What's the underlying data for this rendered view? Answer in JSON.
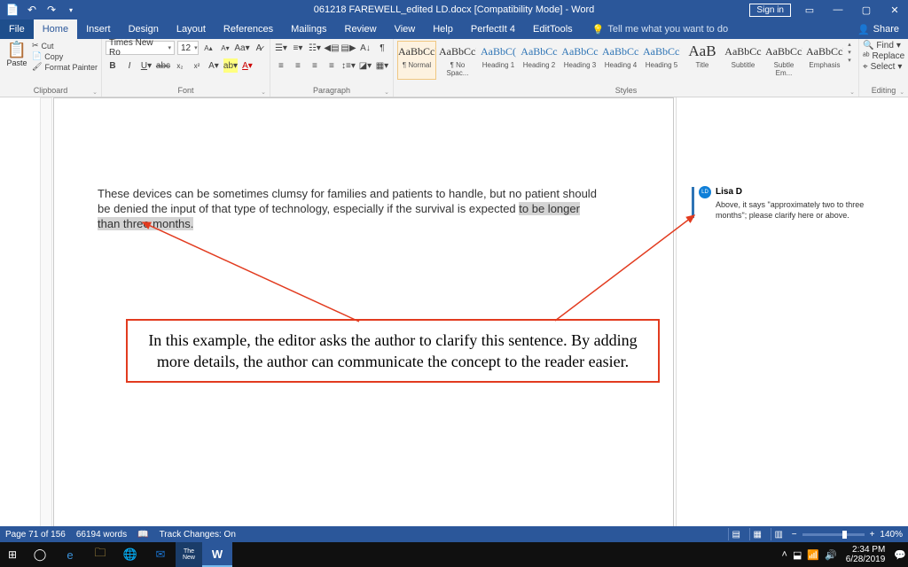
{
  "title": "061218 FAREWELL_edited LD.docx [Compatibility Mode] - Word",
  "signin": "Sign in",
  "tabs": {
    "file": "File",
    "home": "Home",
    "insert": "Insert",
    "design": "Design",
    "layout": "Layout",
    "references": "References",
    "mailings": "Mailings",
    "review": "Review",
    "view": "View",
    "help": "Help",
    "perfectit": "PerfectIt 4",
    "edittools": "EditTools",
    "tellme": "Tell me what you want to do",
    "share": "Share"
  },
  "clipboard": {
    "cut": "Cut",
    "copy": "Copy",
    "fmt": "Format Painter",
    "paste": "Paste",
    "group": "Clipboard"
  },
  "font": {
    "name": "Times New Ro",
    "size": "12",
    "group": "Font"
  },
  "para": {
    "group": "Paragraph"
  },
  "styles": {
    "group": "Styles",
    "items": [
      {
        "prev": "AaBbCcI",
        "name": "¶ Normal",
        "cls": ""
      },
      {
        "prev": "AaBbCcI",
        "name": "¶ No Spac...",
        "cls": ""
      },
      {
        "prev": "AaBbC(",
        "name": "Heading 1",
        "cls": "blue"
      },
      {
        "prev": "AaBbCc",
        "name": "Heading 2",
        "cls": "blue"
      },
      {
        "prev": "AaBbCc",
        "name": "Heading 3",
        "cls": "blue"
      },
      {
        "prev": "AaBbCcI",
        "name": "Heading 4",
        "cls": "blue"
      },
      {
        "prev": "AaBbCcI",
        "name": "Heading 5",
        "cls": "blue"
      },
      {
        "prev": "AaB",
        "name": "Title",
        "cls": "big"
      },
      {
        "prev": "AaBbCc",
        "name": "Subtitle",
        "cls": ""
      },
      {
        "prev": "AaBbCcD",
        "name": "Subtle Em...",
        "cls": ""
      },
      {
        "prev": "AaBbCcD",
        "name": "Emphasis",
        "cls": ""
      }
    ]
  },
  "editing": {
    "find": "Find",
    "replace": "Replace",
    "select": "Select",
    "group": "Editing"
  },
  "document": {
    "line1": "These devices can be sometimes clumsy for families and patients to handle, but no patient should",
    "line2a": "be denied the input of that type of technology, especially if the survival is expected ",
    "line2b": "to be longer",
    "line3": "than three months.",
    "redbox": "In this example, the editor asks the author to clarify this sentence. By adding more details, the author can communicate the concept to the reader easier."
  },
  "comment": {
    "initials": "LD",
    "author": "Lisa D",
    "body": "Above, it says \"approximately two to three months\"; please clarify here or above."
  },
  "status": {
    "page": "Page 71 of 156",
    "words": "66194 words",
    "track": "Track Changes: On",
    "zoom": "140%"
  },
  "clock": {
    "time": "2:34 PM",
    "date": "6/28/2019"
  }
}
